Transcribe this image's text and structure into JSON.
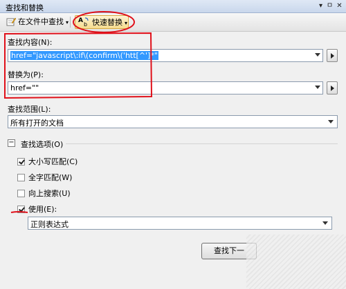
{
  "window": {
    "title": "查找和替换",
    "pin_glyph": "▾",
    "pin2_glyph": "ㅁ",
    "close_glyph": "✕"
  },
  "toolbar": {
    "find_in_files": "在文件中查找",
    "quick_replace": "快速替换"
  },
  "find": {
    "label": "查找内容(N):",
    "value": "href=\"javascript\\:if\\(confirm\\('htt[^']*\""
  },
  "replace": {
    "label": "替换为(P):",
    "value": "href=\"\""
  },
  "scope": {
    "label": "查找范围(L):",
    "value": "所有打开的文档"
  },
  "options": {
    "collapse_glyph": "−",
    "label": "查找选项(O)",
    "match_case": "大小写匹配(C)",
    "match_case_checked": true,
    "whole_word": "全字匹配(W)",
    "whole_word_checked": false,
    "search_up": "向上搜索(U)",
    "search_up_checked": false,
    "use": "使用(E):",
    "use_checked": true,
    "use_mode": "正则表达式"
  },
  "buttons": {
    "find_next": "查找下一"
  },
  "colors": {
    "annotation": "#e0101a",
    "selection": "#3399ff"
  },
  "icons": {
    "find_in_files": "pencil-icon",
    "quick_replace": "replace-ab-icon",
    "side": "arrow-right-icon"
  }
}
